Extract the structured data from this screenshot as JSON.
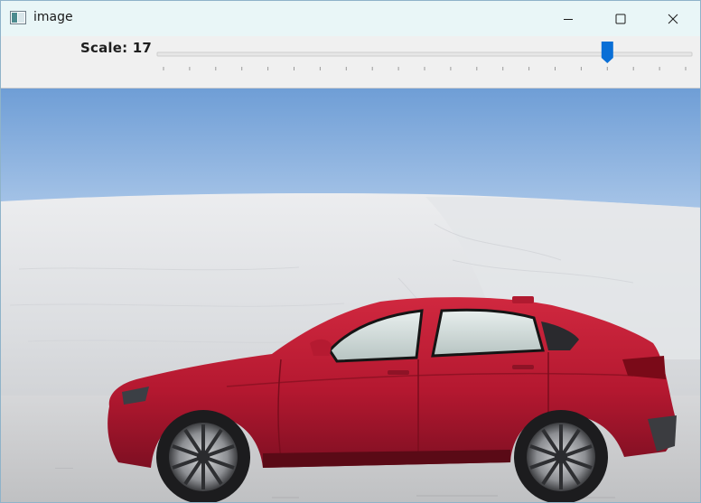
{
  "window": {
    "title": "image",
    "app_icon": "opencv-window-icon",
    "controls": {
      "minimize": "minimize-icon",
      "maximize": "maximize-icon",
      "close": "close-icon"
    }
  },
  "trackbar": {
    "label": "Scale: 17",
    "value": 17,
    "max": 20,
    "accent_color": "#0a6fd6"
  },
  "image": {
    "subject": "red-suv-on-sand-dune"
  }
}
